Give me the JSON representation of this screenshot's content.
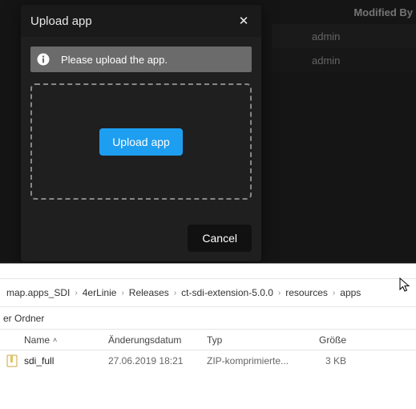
{
  "background": {
    "header": "Modified By",
    "rows": [
      "admin",
      "admin"
    ]
  },
  "dialog": {
    "title": "Upload app",
    "notice": "Please upload the app.",
    "upload_label": "Upload app",
    "cancel_label": "Cancel"
  },
  "explorer": {
    "breadcrumbs": [
      "map.apps_SDI",
      "4erLinie",
      "Releases",
      "ct-sdi-extension-5.0.0",
      "resources",
      "apps"
    ],
    "toolbar_label": "er Ordner",
    "columns": {
      "name": "Name",
      "date": "Änderungsdatum",
      "type": "Typ",
      "size": "Größe"
    },
    "rows": [
      {
        "name": "sdi_full",
        "date": "27.06.2019 18:21",
        "type": "ZIP-komprimierte...",
        "size": "3 KB"
      }
    ]
  }
}
